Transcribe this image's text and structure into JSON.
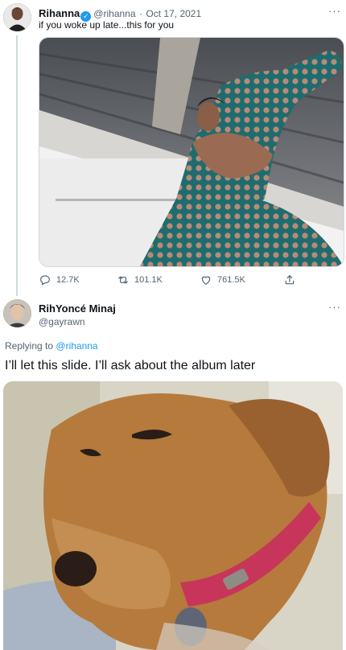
{
  "tweet": {
    "author_name": "Rihanna",
    "handle": "@rihanna",
    "date": "Oct 17, 2021",
    "separator": "·",
    "text": "if you woke up late...this for you",
    "more": "···",
    "stats": {
      "replies": "12.7K",
      "retweets": "101.1K",
      "likes": "761.5K"
    }
  },
  "reply": {
    "author_name": "RihYoncé Minaj",
    "handle": "@gayrawn",
    "more": "···",
    "replying_prefix": "Replying to",
    "replying_to": "@rihanna",
    "text": "I’ll let this slide. I’ll ask about the album later"
  },
  "colors": {
    "accent": "#1d9bf0",
    "muted": "#536471",
    "line": "#cfd9de"
  }
}
